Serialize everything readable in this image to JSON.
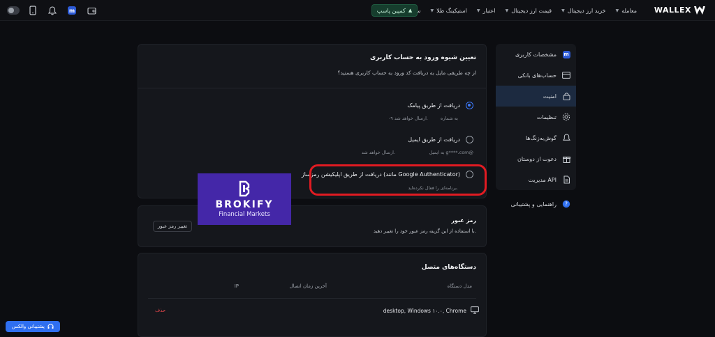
{
  "header": {
    "logo_text": "WALLEX",
    "nav": [
      {
        "label": "معامله"
      },
      {
        "label": "خرید ارز دیجیتال"
      },
      {
        "label": "قیمت ارز دیجیتال"
      },
      {
        "label": "اعتبار"
      },
      {
        "label": "استیکینگ طلا"
      },
      {
        "label": "سایر"
      }
    ],
    "campaign_button": "کمپین پاسپ",
    "avatar_letter": "m"
  },
  "sidebar": {
    "items": [
      {
        "label": "مشخصات کاربری",
        "icon": "profile-icon"
      },
      {
        "label": "حساب‌های بانکی",
        "icon": "card-icon"
      },
      {
        "label": "امنیت",
        "icon": "lock-icon"
      },
      {
        "label": "تنظیمات",
        "icon": "gear-icon"
      },
      {
        "label": "گوش‌به‌زنگ‌ها",
        "icon": "bell-icon"
      },
      {
        "label": "دعوت از دوستان",
        "icon": "gift-icon"
      },
      {
        "label": "مدیریت API",
        "icon": "api-icon"
      }
    ],
    "help": "راهنمایی و پشتیبانی"
  },
  "login_method": {
    "title": "تعیین شیوه ورود به حساب کاربری",
    "question": "از چه طریقی مایل به دریافت کد ورود به حساب کاربری هستید؟",
    "options": [
      {
        "label": "دریافت از طریق پیامک",
        "note_right": "به شماره",
        "note_left": "۰۹ ارسال خواهد شد.",
        "selected": true
      },
      {
        "label": "دریافت از طریق ایمیل",
        "note_right": "به ایمیل g****.com@",
        "note_left": "ارسال خواهد شد.",
        "selected": false
      },
      {
        "label": "دریافت از طریق اپلیکیشن رمزساز (مانند Google Authenticator)",
        "note_right": "برنامه‌ای را فعال نکرده‌اید.",
        "selected": false
      }
    ]
  },
  "password": {
    "title": "رمز عبور",
    "desc": "با استفاده از این گزینه رمز عبور خود را تغییر دهید.",
    "button": "تغییر رمز عبور"
  },
  "devices": {
    "title": "دستگاه‌های متصل",
    "columns": {
      "model": "مدل دستگاه",
      "last_login": "آخرین زمان اتصال",
      "ip": "IP"
    },
    "rows": [
      {
        "device": "desktop, Windows ۱۰.۰, Chrome",
        "action": "حذف"
      }
    ]
  },
  "brand": {
    "name": "BROKIFY",
    "tagline": "Financial Markets"
  },
  "support_button": "پشتیبانی والکس",
  "colors": {
    "accent": "#3d7bff",
    "highlight": "#e11b22",
    "brand_bg": "#4427a8",
    "danger": "#e0454a"
  }
}
